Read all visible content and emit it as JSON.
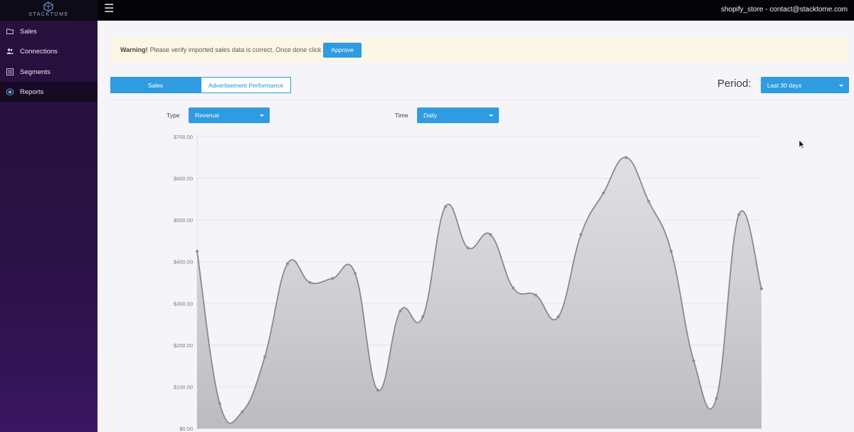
{
  "brand": {
    "name": "STACKTOME"
  },
  "header": {
    "user": "shopify_store - contact@stacktome.com"
  },
  "sidebar": {
    "items": [
      {
        "label": "Sales",
        "icon": "folder-icon"
      },
      {
        "label": "Connections",
        "icon": "users-icon"
      },
      {
        "label": "Segments",
        "icon": "list-icon"
      },
      {
        "label": "Reports",
        "icon": "reports-icon",
        "active": true
      }
    ]
  },
  "warning": {
    "title": "Warning!",
    "message": "Please verify imported sales data is correct. Once done click",
    "button": "Approve"
  },
  "tabs": [
    {
      "label": "Sales",
      "active": true
    },
    {
      "label": "Advertisement Performance",
      "active": false
    }
  ],
  "period": {
    "label": "Period:",
    "value": "Last 30 days"
  },
  "filters": {
    "type_label": "Type",
    "type_value": "Revenue",
    "time_label": "Time",
    "time_value": "Daily"
  },
  "colors": {
    "accent": "#2f9be1",
    "sidebar": "#2a1144",
    "topbar": "#050409",
    "line": "#8a8a8e",
    "fill": "#d9d8dc"
  },
  "chart_data": {
    "type": "area",
    "title": "",
    "xlabel": "",
    "ylabel": "",
    "ylim": [
      0,
      700
    ],
    "y_ticks": [
      "$0.00",
      "$100.00",
      "$200.00",
      "$300.00",
      "$400.00",
      "$500.00",
      "$600.00",
      "$700.00"
    ],
    "grid": true,
    "series": [
      {
        "values": [
          425,
          60,
          40,
          172,
          395,
          350,
          360,
          372,
          92,
          282,
          268,
          532,
          433,
          465,
          337,
          320,
          268,
          465,
          565,
          650,
          545,
          425,
          162,
          72,
          513,
          335
        ]
      }
    ]
  }
}
